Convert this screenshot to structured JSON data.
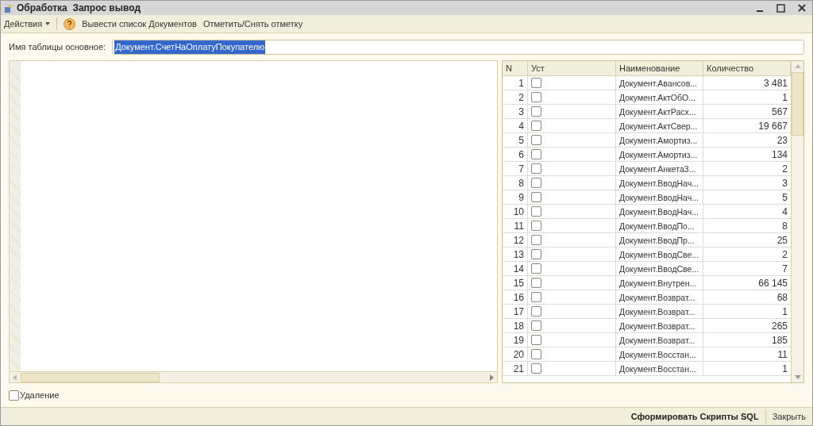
{
  "window": {
    "title": "Обработка  Запрос вывод"
  },
  "toolbar": {
    "actions_menu": "Действия",
    "buttons": [
      "Вывести список Документов",
      "Отметить/Снять отметку"
    ]
  },
  "main_table_field": {
    "label": "Имя таблицы основное:",
    "value": "Документ.СчетНаОплатуПокупателю",
    "text_selected": true
  },
  "table": {
    "columns": [
      "N",
      "Уст",
      "Наименование",
      "Количество"
    ],
    "rows": [
      {
        "n": "1",
        "checked": false,
        "name": "Документ.Авансов...",
        "count": "3 481"
      },
      {
        "n": "2",
        "checked": false,
        "name": "Документ.АктОбО...",
        "count": "1"
      },
      {
        "n": "3",
        "checked": false,
        "name": "Документ.АктРасх...",
        "count": "567"
      },
      {
        "n": "4",
        "checked": false,
        "name": "Документ.АктСвер...",
        "count": "19 667"
      },
      {
        "n": "5",
        "checked": false,
        "name": "Документ.Амортиз...",
        "count": "23"
      },
      {
        "n": "6",
        "checked": false,
        "name": "Документ.Амортиз...",
        "count": "134"
      },
      {
        "n": "7",
        "checked": false,
        "name": "Документ.Анкета3...",
        "count": "2"
      },
      {
        "n": "8",
        "checked": false,
        "name": "Документ.ВводНач...",
        "count": "3"
      },
      {
        "n": "9",
        "checked": false,
        "name": "Документ.ВводНач...",
        "count": "5"
      },
      {
        "n": "10",
        "checked": false,
        "name": "Документ.ВводНач...",
        "count": "4"
      },
      {
        "n": "11",
        "checked": false,
        "name": "Документ.ВводПо...",
        "count": "8"
      },
      {
        "n": "12",
        "checked": false,
        "name": "Документ.ВводПр...",
        "count": "25"
      },
      {
        "n": "13",
        "checked": false,
        "name": "Документ.ВводСве...",
        "count": "2"
      },
      {
        "n": "14",
        "checked": false,
        "name": "Документ.ВводСве...",
        "count": "7"
      },
      {
        "n": "15",
        "checked": false,
        "name": "Документ.Внутрен...",
        "count": "66 145"
      },
      {
        "n": "16",
        "checked": false,
        "name": "Документ.Возврат...",
        "count": "68"
      },
      {
        "n": "17",
        "checked": false,
        "name": "Документ.Возврат...",
        "count": "1"
      },
      {
        "n": "18",
        "checked": false,
        "name": "Документ.Возврат...",
        "count": "265"
      },
      {
        "n": "19",
        "checked": false,
        "name": "Документ.Возврат...",
        "count": "185"
      },
      {
        "n": "20",
        "checked": false,
        "name": "Документ.Восстан...",
        "count": "11"
      },
      {
        "n": "21",
        "checked": false,
        "name": "Документ.Восстан...",
        "count": "1"
      }
    ]
  },
  "deletion": {
    "label": "Удаление",
    "checked": false
  },
  "footer": {
    "buttons": [
      {
        "label": "Сформировать Скрипты SQL",
        "default": true
      },
      {
        "label": "Закрыть",
        "default": false
      }
    ]
  }
}
